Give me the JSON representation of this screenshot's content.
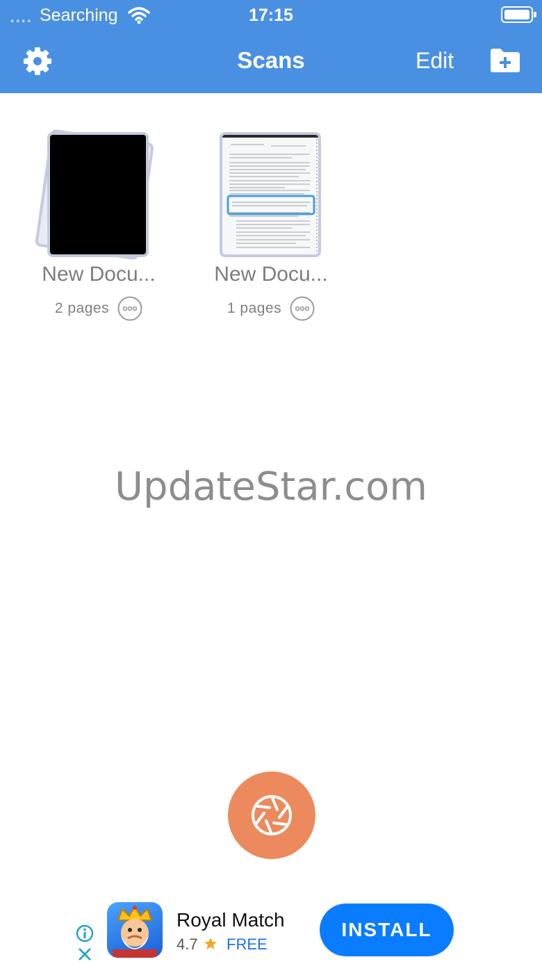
{
  "status_bar": {
    "signal": "••••",
    "carrier": "Searching",
    "time": "17:15"
  },
  "nav": {
    "title": "Scans",
    "edit_label": "Edit",
    "left_icon": "gear-icon",
    "right_icon": "folder-add-icon"
  },
  "documents": [
    {
      "title": "New Docu...",
      "pages": "2 pages"
    },
    {
      "title": "New Docu...",
      "pages": "1 pages"
    }
  ],
  "watermark": "UpdateStar.com",
  "ad": {
    "app_name": "Royal Match",
    "rating": "4.7",
    "price": "FREE",
    "install_label": "INSTALL"
  },
  "colors": {
    "header": "#4a90e2",
    "shutter": "#ec8a5e",
    "install": "#0a7cff"
  }
}
